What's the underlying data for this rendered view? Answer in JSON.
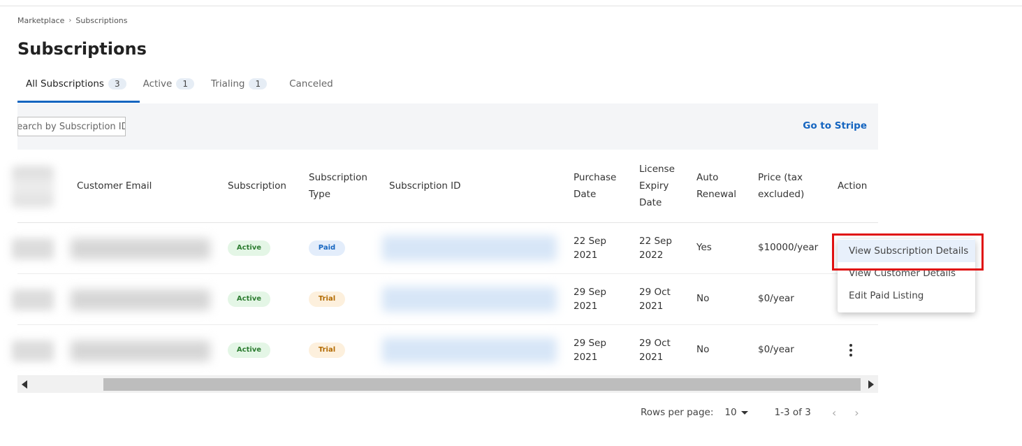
{
  "breadcrumb": {
    "items": [
      "Marketplace",
      "Subscriptions"
    ],
    "separator": "›"
  },
  "page_title": "Subscriptions",
  "tabs": [
    {
      "label": "All Subscriptions",
      "count": "3"
    },
    {
      "label": "Active",
      "count": "1"
    },
    {
      "label": "Trialing",
      "count": "1"
    },
    {
      "label": "Canceled",
      "count": ""
    }
  ],
  "toolbar": {
    "search_placeholder": "Search by Subscription ID",
    "go_to_stripe": "Go to Stripe"
  },
  "table": {
    "columns": {
      "customer_email": "Customer Email",
      "subscription": "Subscription",
      "subscription_type_1": "Subscription",
      "subscription_type_2": "Type",
      "subscription_id": "Subscription ID",
      "purchase_date_1": "Purchase",
      "purchase_date_2": "Date",
      "license_1": "License",
      "license_2": "Expiry",
      "license_3": "Date",
      "auto_1": "Auto",
      "auto_2": "Renewal",
      "price_1": "Price (tax",
      "price_2": "excluded)",
      "action": "Action"
    },
    "rows": [
      {
        "status": "Active",
        "type": "Paid",
        "purchase_1": "22 Sep",
        "purchase_2": "2021",
        "expiry_1": "22 Sep",
        "expiry_2": "2022",
        "auto_renewal": "Yes",
        "price": "$10000/year"
      },
      {
        "status": "Active",
        "type": "Trial",
        "purchase_1": "29 Sep",
        "purchase_2": "2021",
        "expiry_1": "29 Oct",
        "expiry_2": "2021",
        "auto_renewal": "No",
        "price": "$0/year"
      },
      {
        "status": "Active",
        "type": "Trial",
        "purchase_1": "29 Sep",
        "purchase_2": "2021",
        "expiry_1": "29 Oct",
        "expiry_2": "2021",
        "auto_renewal": "No",
        "price": "$0/year"
      }
    ]
  },
  "context_menu": {
    "items": [
      "View Subscription Details",
      "View Customer Details",
      "Edit Paid Listing"
    ]
  },
  "pagination": {
    "rows_per_page_label": "Rows per page:",
    "rows_per_page_value": "10",
    "range": "1-3 of 3",
    "prev": "‹",
    "next": "›"
  },
  "colors": {
    "accent": "#1565c0",
    "active_badge": "#2e7d32",
    "trial_badge": "#b26a00",
    "highlight_box": "#e01010"
  }
}
